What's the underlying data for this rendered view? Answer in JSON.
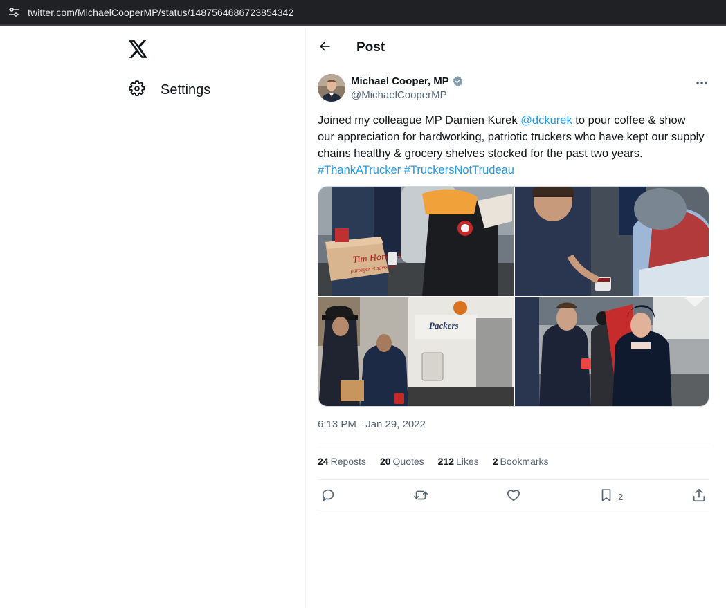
{
  "browser": {
    "url": "twitter.com/MichaelCooperMP/status/1487564686723854342",
    "site_info_icon": "tune-icon"
  },
  "nav": {
    "logo_icon": "x-logo-icon",
    "settings_label": "Settings",
    "settings_icon": "gear-icon"
  },
  "header": {
    "title": "Post",
    "back_icon": "arrow-left-icon"
  },
  "author": {
    "name": "Michael Cooper, MP",
    "handle": "@MichaelCooperMP",
    "verified_color": "#829aab",
    "more_icon": "more-horizontal-icon"
  },
  "tweet": {
    "text_before": "Joined my colleague MP Damien Kurek ",
    "mention": "@dckurek",
    "text_after": " to pour coffee & show our appreciation for hardworking, patriotic truckers who have kept our supply chains healthy & grocery shelves stocked for the past two years.",
    "hashtag1": "#ThankATrucker",
    "hashtag2": "#TruckersNotTrudeau",
    "link_color": "#1d9bf0",
    "photo1_box_text": "Tim Hortons",
    "photo1_box_subtext": "partagez et savourez",
    "photo3_truck_text": "Packers"
  },
  "meta": {
    "timestamp": "6:13 PM · Jan 29, 2022"
  },
  "stats": {
    "reposts_count": "24",
    "reposts_label": "Reposts",
    "quotes_count": "20",
    "quotes_label": "Quotes",
    "likes_count": "212",
    "likes_label": "Likes",
    "bookmarks_count": "2",
    "bookmarks_label": "Bookmarks"
  },
  "actions": {
    "reply_icon": "reply-icon",
    "repost_icon": "repost-icon",
    "like_icon": "heart-icon",
    "bookmark_icon": "bookmark-icon",
    "bookmark_count": "2",
    "share_icon": "share-icon"
  }
}
